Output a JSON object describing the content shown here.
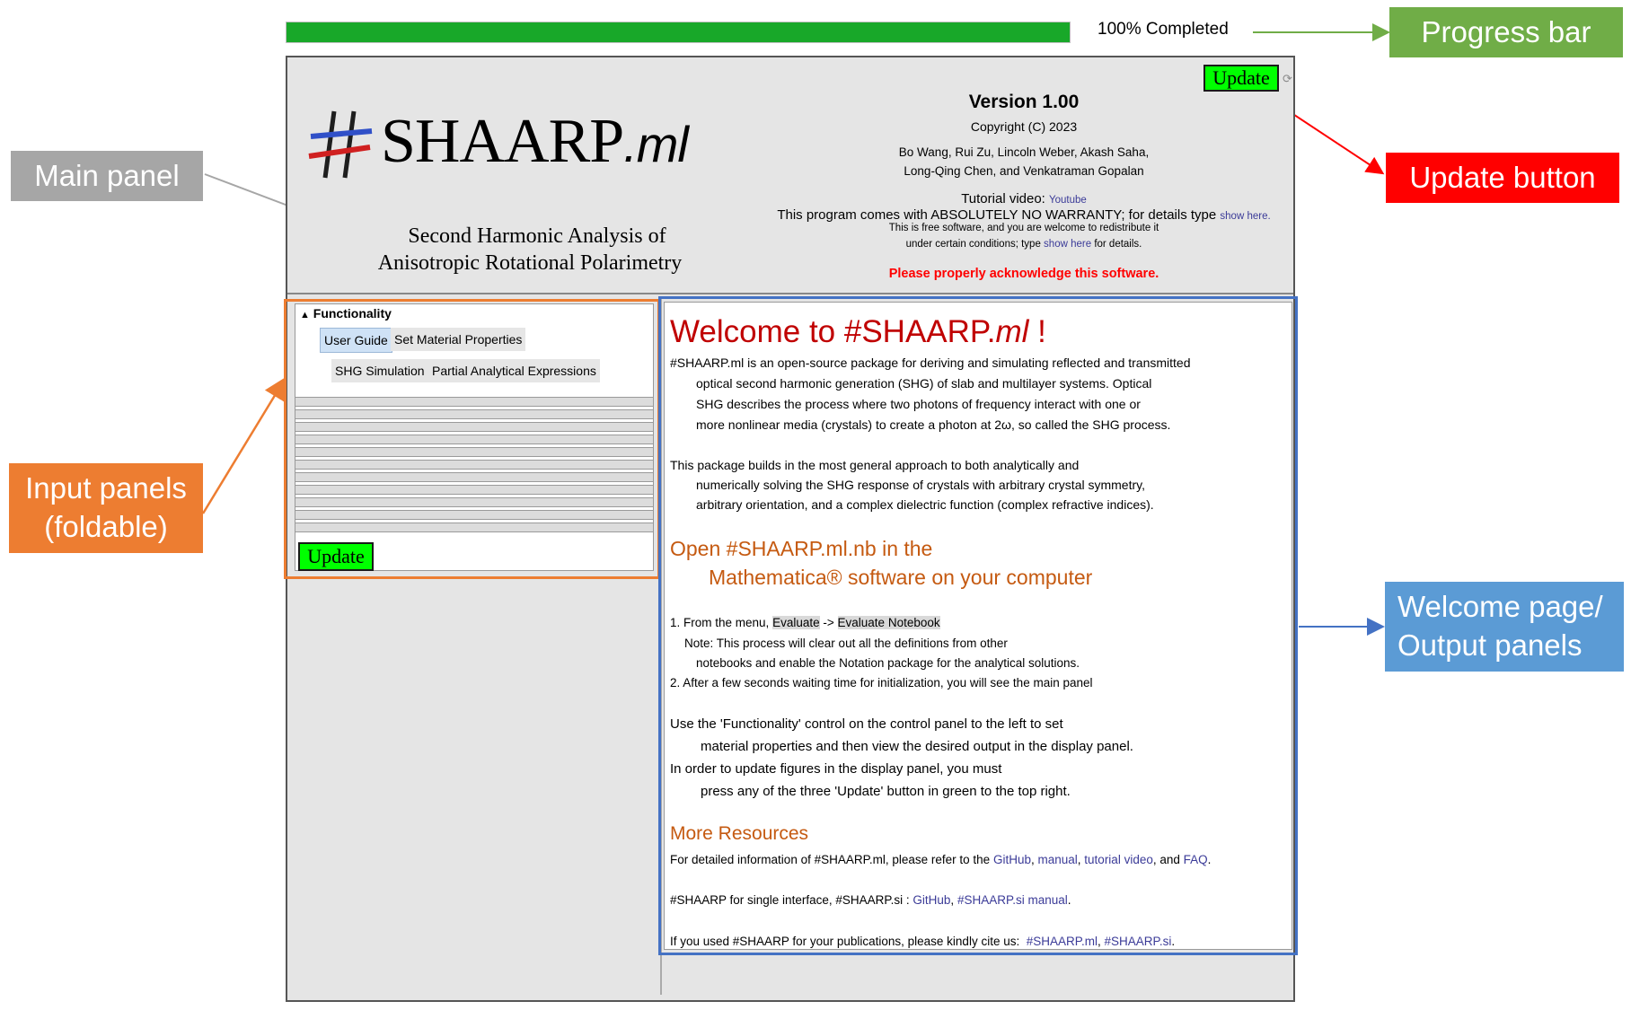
{
  "progress": {
    "percent": 100,
    "text": "100% Completed",
    "color": "#18a829"
  },
  "callouts": {
    "progress_bar": "Progress bar",
    "update_button": "Update button",
    "main_panel": "Main panel",
    "input_panels": "Input panels (foldable)",
    "welcome_output": "Welcome page/ Output panels"
  },
  "header": {
    "update_label": "Update",
    "logo_hash": "#",
    "logo_name": "SHAARP",
    "logo_suffix": ".ml",
    "subtitle_line1": "Second Harmonic Analysis of",
    "subtitle_line2": "Anisotropic Rotational Polarimetry",
    "version": "Version 1.00",
    "copyright": "Copyright (C) 2023",
    "authors_line1": "Bo Wang, Rui Zu, Lincoln Weber, Akash Saha,",
    "authors_line2": "Long-Qing Chen, and Venkatraman Gopalan",
    "tutorial_label": "Tutorial video:",
    "tutorial_link": "Youtube",
    "warranty_text": "This program comes with ABSOLUTELY NO WARRANTY; for details type",
    "show_here": "show here.",
    "free_line1": "This is free software, and you are welcome to redistribute it",
    "free_line2_pre": "under certain conditions; type",
    "free_line2_link": "show here",
    "free_line2_post": "for details.",
    "acknowledge": "Please properly acknowledge this software."
  },
  "input_panel": {
    "functionality_label": "Functionality",
    "tabs": [
      "User Guide",
      "Set Material Properties",
      "SHG Simulation",
      "Partial Analytical Expressions"
    ],
    "fold_count": 11,
    "update_label": "Update"
  },
  "welcome": {
    "title_pre": "Welcome to #SHAARP.",
    "title_ml": "ml",
    "title_post": " !",
    "para1": [
      "#SHAARP.ml is an open-source package for deriving and simulating reflected and transmitted",
      "optical second harmonic generation (SHG) of slab and multilayer systems. Optical",
      "SHG describes the process where two photons of frequency interact with one or",
      "more nonlinear media (crystals) to create a photon at 2ω, so called the SHG process."
    ],
    "para2": [
      "This package builds in the most general approach to both analytically and",
      "numerically solving the SHG response of crystals with arbitrary crystal symmetry,",
      "arbitrary orientation, and a complex dielectric function (complex refractive indices)."
    ],
    "open_line1": "Open #SHAARP.ml.nb in the",
    "open_line2": "Mathematica® software on your computer",
    "step1_pre": "1. From the menu,",
    "step1_eval": "Evaluate",
    "step1_arrow": "->",
    "step1_eval_nb": "Evaluate Notebook",
    "note_line1": "Note: This process will clear out all the definitions from other",
    "note_line2": "notebooks and enable the Notation package for the analytical solutions.",
    "step2": "2. After a few seconds waiting time for initialization, you will see the main panel",
    "use_lines": [
      "Use the 'Functionality' control on the control panel to the left to set",
      "material properties and then view the desired output in the display panel.",
      "In order to update figures in the display panel, you must",
      "press any of the three 'Update' button in green to the top right."
    ],
    "more_resources": "More Resources",
    "detail_pre": "For detailed information of #SHAARP.ml, please refer to the",
    "detail_links": [
      "GitHub",
      "manual",
      "tutorial video",
      "FAQ"
    ],
    "detail_and": "and",
    "si_pre": "#SHAARP for single interface, #SHAARP.si :",
    "si_links": [
      "GitHub",
      "#SHAARP.si manual"
    ],
    "cite_pre": "If you used #SHAARP for your publications, please kindly cite us:",
    "cite_links": [
      "#SHAARP.ml",
      "#SHAARP.si"
    ]
  }
}
